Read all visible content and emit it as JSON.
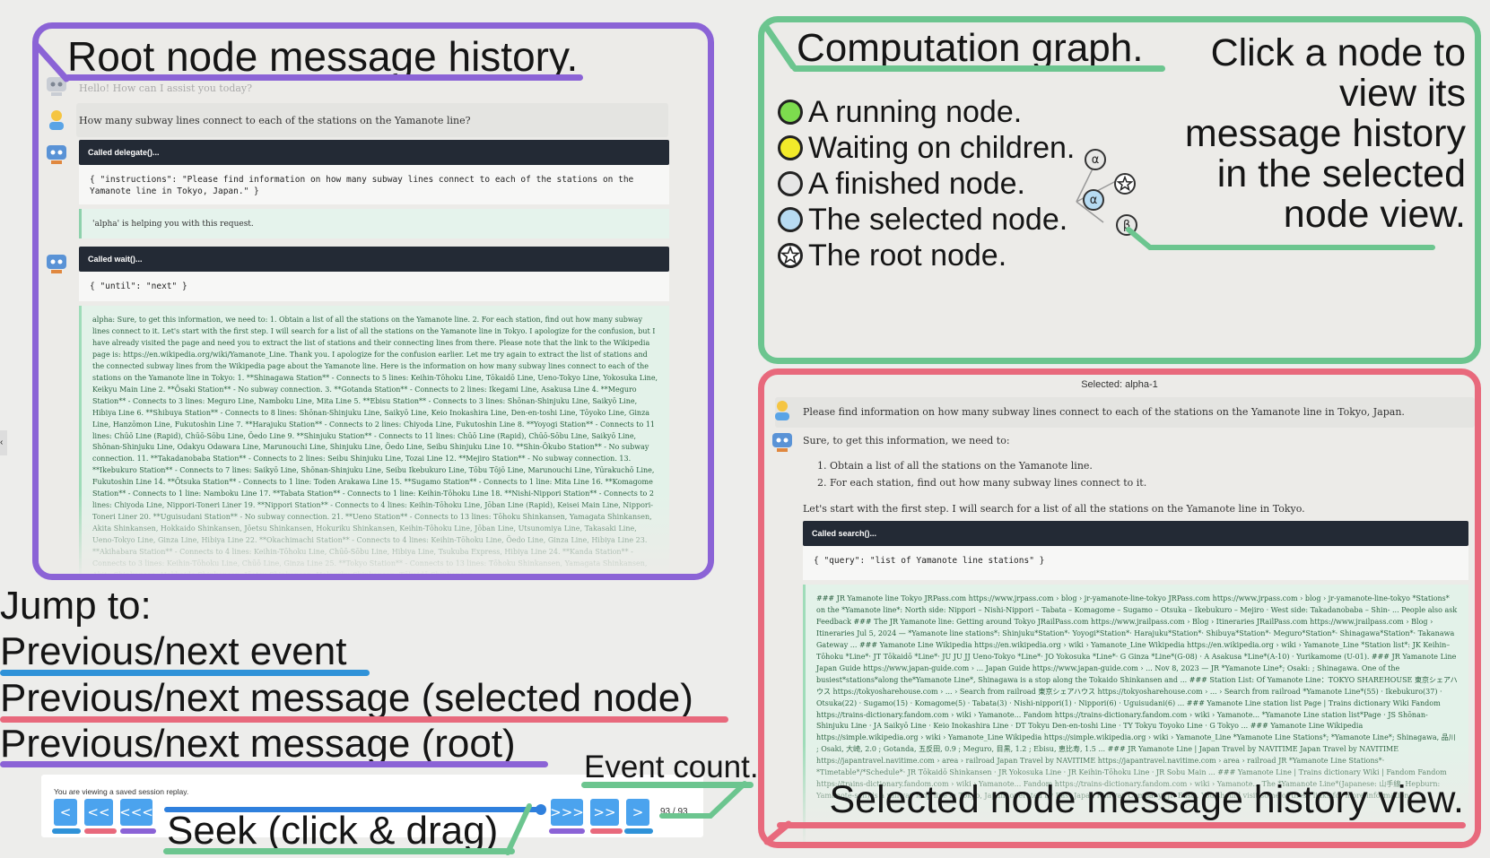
{
  "root_panel": {
    "title": "Root node message history.",
    "greeting": "Hello! How can I assist you today?",
    "user_question": "How many subway lines connect to each of the stations on the Yamanote line?",
    "call1": {
      "header": "Called delegate()...",
      "code": "{ \"instructions\": \"Please find information on how many subway lines connect to each of the stations on the Yamanote line in Tokyo, Japan.\" }",
      "note": "'alpha' is helping you with this request."
    },
    "call2": {
      "header": "Called wait()...",
      "code": "{ \"until\": \"next\" }",
      "result": "alpha: Sure, to get this information, we need to: 1. Obtain a list of all the stations on the Yamanote line. 2. For each station, find out how many subway lines connect to it. Let's start with the first step. I will search for a list of all the stations on the Yamanote line in Tokyo. I apologize for the confusion, but I have already visited the page and need you to extract the list of stations and their connecting lines from there. Please note that the link to the Wikipedia page is: https://en.wikipedia.org/wiki/Yamanote_Line. Thank you. I apologize for the confusion earlier. Let me try again to extract the list of stations and the connected subway lines from the Wikipedia page about the Yamanote line. Here is the information on how many subway lines connect to each of the stations on the Yamanote line in Tokyo: 1. **Shinagawa Station** - Connects to 5 lines: Keihin-Tōhoku Line, Tōkaidō Line, Ueno-Tokyo Line, Yokosuka Line, Keikyu Main Line 2. **Ōsaki Station** - No subway connection. 3. **Gotanda Station** - Connects to 2 lines: Ikegami Line, Asakusa Line 4. **Meguro Station** - Connects to 3 lines: Meguro Line, Namboku Line, Mita Line 5. **Ebisu Station** - Connects to 3 lines: Shōnan-Shinjuku Line, Saikyō Line, Hibiya Line 6. **Shibuya Station** - Connects to 8 lines: Shōnan-Shinjuku Line, Saikyō Line, Keio Inokashira Line, Den-en-toshi Line, Tōyoko Line, Ginza Line, Hanzōmon Line, Fukutoshin Line 7. **Harajuku Station** - Connects to 2 lines: Chiyoda Line, Fukutoshin Line 8. **Yoyogi Station** - Connects to 11 lines: Chūō Line (Rapid), Chūō-Sōbu Line, Ōedo Line 9. **Shinjuku Station** - Connects to 11 lines: Chūō Line (Rapid), Chūō-Sōbu Line, Saikyō Line, Shōnan-Shinjuku Line, Odakyu Odawara Line, Marunouchi Line, Shinjuku Line, Ōedo Line, Seibu Shinjuku Line 10. **Shin-Ōkubo Station** - No subway connection. 11. **Takadanobaba Station** - Connects to 2 lines: Seibu Shinjuku Line, Tozai Line 12. **Mejiro Station** - No subway connection. 13. **Ikebukuro Station** - Connects to 7 lines: Saikyō Line, Shōnan-Shinjuku Line, Seibu Ikebukuro Line, Tōbu Tōjō Line, Marunouchi Line, Yūrakuchō Line, Fukutoshin Line 14. **Ōtsuka Station** - Connects to 1 line: Toden Arakawa Line 15. **Sugamo Station** - Connects to 1 line: Mita Line 16. **Komagome Station** - Connects to 1 line: Namboku Line 17. **Tabata Station** - Connects to 1 line: Keihin-Tōhoku Line 18. **Nishi-Nippori Station** - Connects to 2 lines: Chiyoda Line, Nippori-Toneri Liner 19. **Nippori Station** - Connects to 4 lines: Keihin-Tōhoku Line, Jōban Line (Rapid), Keisei Main Line, Nippori-Toneri Liner 20. **Uguisudani Station** - No subway connection. 21. **Ueno Station** - Connects to 13 lines: Tōhoku Shinkansen, Yamagata Shinkansen, Akita Shinkansen, Hokkaido Shinkansen, Jōetsu Shinkansen, Hokuriku Shinkansen, Keihin-Tōhoku Line, Jōban Line, Utsunomiya Line, Takasaki Line, Ueno-Tokyo Line, Ginza Line, Hibiya Line 22. **Okachimachi Station** - Connects to 4 lines: Keihin-Tōhoku Line, Ōedo Line, Ginza Line, Hibiya Line 23. **Akihabara Station** - Connects to 4 lines: Keihin-Tōhoku Line, Chūō-Sōbu Line, Hibiya Line, Tsukuba Express, Hibiya Line 24. **Kanda Station** - Connects to 3 lines: Keihin-Tōhoku Line, Chūō Line, Ginza Line 25. **Tokyo Station** - Connects to 13 lines: Tōhoku Shinkansen, Yamagata Shinkansen, Akita Shinkansen, Hokkaido Shinkansen, Jōetsu Shinkansen, Hokuriku Shinkansen, Tōkaidō Shinkansen"
    }
  },
  "graph_panel": {
    "title": "Computation graph.",
    "legend": [
      {
        "label": "A running node.",
        "color": "#7ddc4e"
      },
      {
        "label": "Waiting on children.",
        "color": "#f2ea2a"
      },
      {
        "label": "A finished node.",
        "color": "#e6e6e6"
      },
      {
        "label": "The selected node.",
        "color": "#b7dbf2"
      },
      {
        "label": "The root node.",
        "color": "#ffffff"
      }
    ],
    "nodes": {
      "alpha_top": "α",
      "alpha_selected": "α",
      "beta": "β"
    },
    "help_text": [
      "Click a node to",
      "view its",
      "message history",
      "in the selected",
      "node view."
    ]
  },
  "selected_panel": {
    "header": "Selected: alpha-1",
    "user_message": "Please find information on how many subway lines connect to each of the stations on the Yamanote line in Tokyo, Japan.",
    "assistant_intro": "Sure, to get this information, we need to:",
    "steps": [
      "1. Obtain a list of all the stations on the Yamanote line.",
      "2. For each station, find out how many subway lines connect to it."
    ],
    "assistant_followup": "Let's start with the first step. I will search for a list of all the stations on the Yamanote line in Tokyo.",
    "call": {
      "header": "Called search()...",
      "code": "{ \"query\": \"list of Yamanote line stations\" }",
      "result": "### JR Yamanote line Tokyo JRPass.com https://www.jrpass.com › blog › jr-yamanote-line-tokyo JRPass.com https://www.jrpass.com › blog › jr-yamanote-line-tokyo *Stations* on the *Yamanote line*: North side: Nippori – Nishi-Nippori – Tabata – Komagome – Sugamo – Otsuka – Ikebukuro – Mejiro · West side: Takadanobaba – Shin- ... People also ask Feedback ### The JR Yamanote line: Getting around Tokyo JRailPass.com https://www.jrailpass.com › Blog › Itineraries JRailPass.com https://www.jrailpass.com › Blog › Itineraries Jul 5, 2024 — *Yamanote line stations*: Shinjuku*Station*· Yoyogi*Station*· Harajuku*Station*· Shibuya*Station*· Meguro*Station*· Shinagawa*Station*· Takanawa Gateway ... ### Yamanote Line Wikipedia https://en.wikipedia.org › wiki › Yamanote_Line Wikipedia https://en.wikipedia.org › wiki › Yamanote_Line *Station list*: JK Keihin–Tōhoku *Line*· JT Tōkaidō *Line*· JU JU JJ Ueno-Tokyo *Line*· JO Yokosuka *Line*· G Ginza *Line*(G-08) · A Asakusa *Line*(A-10) · Yurikamome (U-01). ### JR Yamanote Line Japan Guide https://www.japan-guide.com › ... Japan Guide https://www.japan-guide.com › ... Nov 8, 2023 — JR *Yamanote Line*; Osaki: ; Shinagawa. One of the busiest*stations*along the*Yamanote Line*, Shinagawa is a stop along the Tokaido Shinkansen and ... ### Station List: Of Yamanote Line：TOKYO SHAREHOUSE 東京シェアハウス https://tokyosharehouse.com › ... › Search from railroad 東京シェアハウス https://tokyosharehouse.com › ... › Search from railroad *Yamanote Line*(55) · Ikebukuro(37) · Otsuka(22) · Sugamo(15) · Komagome(5) · Tabata(3) · Nishi-nippori(1) · Nippori(6) · Uguisudani(6) ... ### Yamanote Line station list Page | Trains dictionary Wiki Fandom https://trains-dictionary.fandom.com › wiki › Yamanote... Fandom https://trains-dictionary.fandom.com › wiki › Yamanote... *Yamanote Line station list*Page · JS Shōnan-Shinjuku Line · JA Saikyō Line · Keio Inokashira Line · DT Tokyu Den-en-toshi Line · TY Tokyu Toyoko Line · G Tokyo ... ### Yamanote Line Wikipedia https://simple.wikipedia.org › wiki › Yamanote_Line Wikipedia https://simple.wikipedia.org › wiki › Yamanote_Line *Yamanote Line Stations*; *Yamanote Line*; Shinagawa, 品川 ; Osaki, 大崎, 2.0 ; Gotanda, 五反田, 0.9 ; Meguro, 目黒, 1.2 ; Ebisu, 恵比寿, 1.5 ... ### JR Yamanote Line | Japan Travel by NAVITIME Japan Travel by NAVITIME https://japantravel.navitime.com › area › railroad Japan Travel by NAVITIME https://japantravel.navitime.com › area › railroad JR *Yamanote Line Stations*· *Timetable*/*Schedule*· JR Tōkaidō Shinkansen · JR Yokosuka Line · JR Keihin-Tōhoku Line · JR Sobu Main ... ### Yamanote Line | Trains dictionary Wiki | Fandom Fandom https://trains-dictionary.fandom.com › wiki › Yamanote... Fandom https://trains-dictionary.fandom.com › wiki › Yamanote... The *Yamanote Line*(Japanese: 山手線, Hepburn: Yamanote-sen) is a railway loop line in Tokyo, Japan, operated by East Japan Railway Company (JR East). You should visit some of these links for more information."
    },
    "caption": "Selected node message history view."
  },
  "jump": {
    "title": "Jump to:",
    "items": [
      {
        "label": "Previous/next event",
        "color": "#2f92d8"
      },
      {
        "label": "Previous/next message (selected node)",
        "color": "#e8697c"
      },
      {
        "label": "Previous/next message (root)",
        "color": "#8b63d6"
      }
    ]
  },
  "player": {
    "banner": "You are viewing a saved session replay.",
    "buttons_left": [
      "<",
      "<<",
      "<<<"
    ],
    "buttons_right": [
      ">>>",
      ">>",
      ">"
    ],
    "event_count": "93 / 93",
    "progress": 1.0,
    "seek_label": "Seek (click & drag)",
    "event_count_label": "Event count."
  },
  "colors": {
    "root": "#8b63d6",
    "graph": "#6cc58f",
    "selected": "#e8697c",
    "event": "#2f92d8",
    "button": "#4ba3ee"
  }
}
